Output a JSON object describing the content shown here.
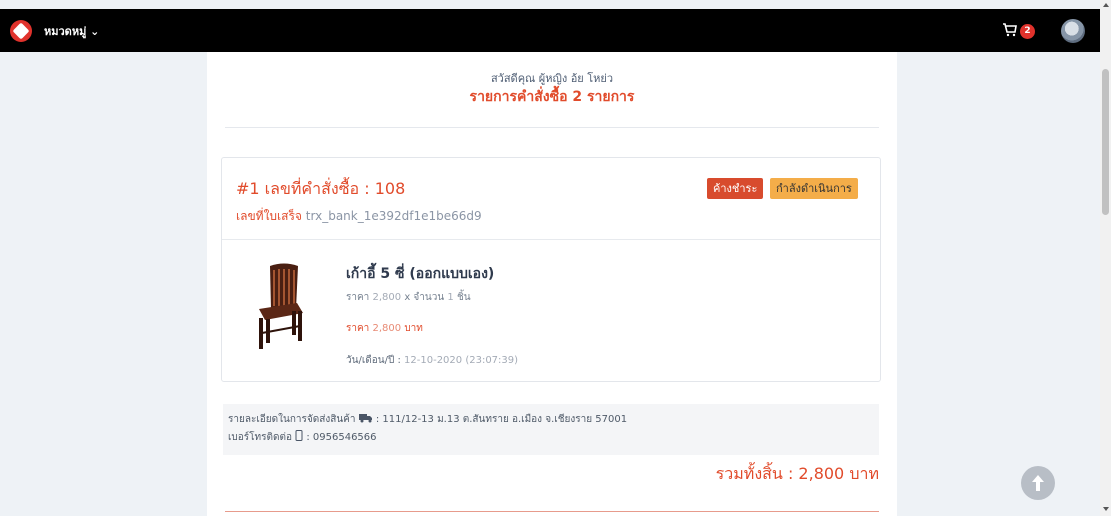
{
  "navbar": {
    "category_label": "หมวดหมู่",
    "cart_count": "2"
  },
  "order_page": {
    "greeting": "สวัสดีคุณ ผู้หญิง อ้ย โหย่ว",
    "title": "รายการคำสั่งซื้อ 2 รายการ"
  },
  "order": {
    "number_title": "#1 เลขที่คำสั่งซื้อ : 108",
    "receipt_label": "เลขที่ใบเสร็จ",
    "receipt_value": "trx_bank_1e392df1e1be66d9",
    "payment_status": "ค้างชำระ",
    "processing_status": "กำลังดำเนินการ",
    "product": {
      "name": "เก้าอี้ 5 ซี่ (ออกแบบเอง)",
      "price_label": "ราคา",
      "price_value": "2,800",
      "quantity_separator": "x",
      "quantity_label": "จำนวน",
      "quantity_value": "1",
      "quantity_unit": "ชิ้น",
      "total_label": "ราคา",
      "total_value": "2,800",
      "total_unit": "บาท",
      "date_label": "วัน/เดือน/ปี :",
      "date_value": "12-10-2020 (23:07:39)"
    },
    "shipping_label": "รายละเอียดในการจัดส่งสินค้า",
    "shipping_value": ": 111/12-13 ม.13 ต.สันทราย อ.เมือง จ.เชียงราย 57001",
    "phone_label": "เบอร์โทรติดต่อ",
    "phone_value": ": 0956546566",
    "grand_total": "รวมทั้งสิ้น : 2,800 บาท"
  },
  "icons": {
    "logo": "heart-logo-icon",
    "category": "chevron-down-icon",
    "cart": "cart-icon",
    "truck": "truck-icon",
    "phone": "phone-icon",
    "back_to_top": "arrow-up-icon"
  },
  "colors": {
    "accent": "#e14b2b",
    "payment_badge": "#d84b2d",
    "status_badge": "#f4ad49",
    "navbar": "#000000"
  }
}
